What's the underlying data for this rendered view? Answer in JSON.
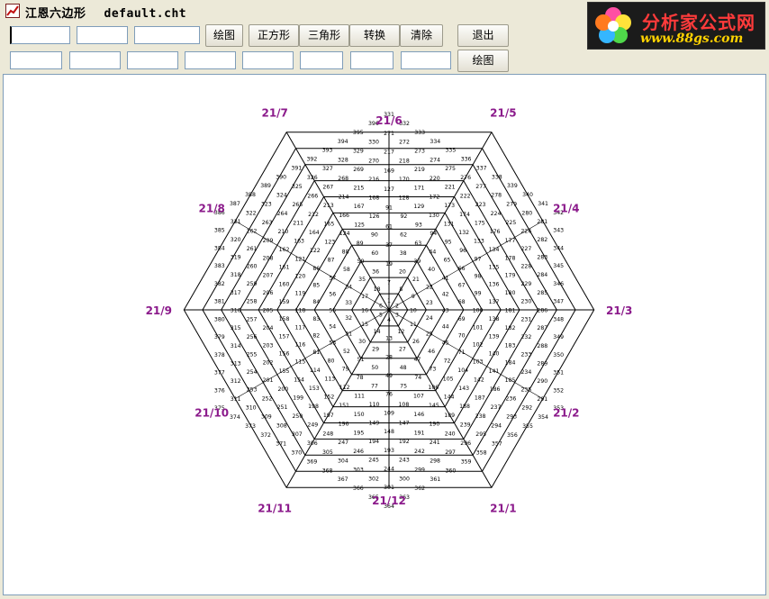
{
  "window": {
    "title": "江恩六边形",
    "filename": "default.cht"
  },
  "logo": {
    "text": "分析家公式网",
    "url": "www.88gs.com"
  },
  "toolbar": {
    "row1_inputs": [
      "",
      "",
      ""
    ],
    "draw1": "绘图",
    "square": "正方形",
    "triangle": "三角形",
    "convert": "转换",
    "clear": "清除",
    "exit": "退出",
    "row2_inputs": [
      "",
      "",
      "",
      "",
      "",
      "",
      "",
      ""
    ],
    "draw2": "绘图"
  },
  "chart": {
    "start_number": 1,
    "rings": 11,
    "direction_labels": [
      "21/1",
      "21/2",
      "21/3",
      "21/4",
      "21/5",
      "21/6",
      "21/7",
      "21/8",
      "21/9",
      "21/10",
      "21/11",
      "21/12"
    ],
    "line_color": "#000000",
    "label_color": "#8b1a8b"
  }
}
